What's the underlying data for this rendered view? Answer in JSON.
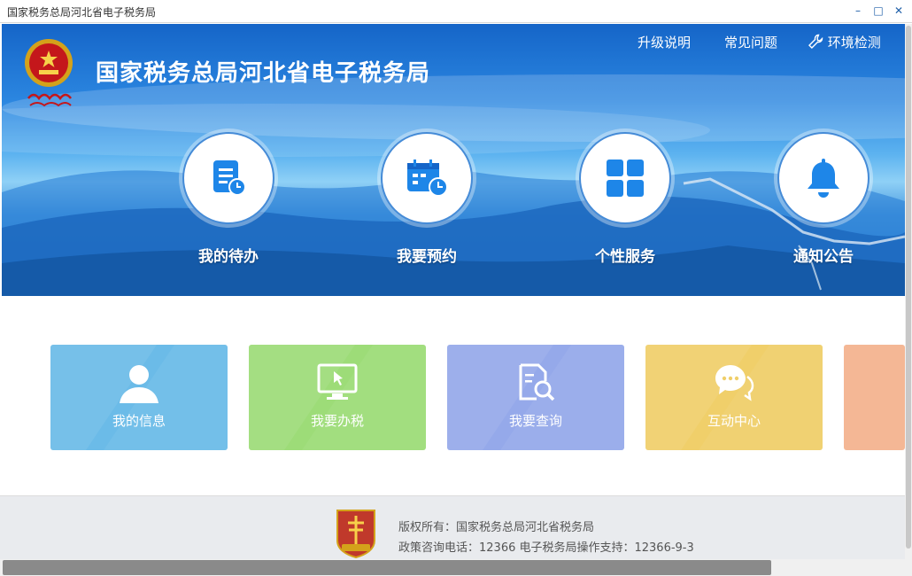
{
  "window": {
    "title": "国家税务总局河北省电子税务局",
    "minimize": "–",
    "maximize": "□",
    "close": "✕"
  },
  "header": {
    "site_title": "国家税务总局河北省电子税务局",
    "links": [
      {
        "label": "升级说明",
        "icon": "none"
      },
      {
        "label": "常见问题",
        "icon": "none"
      },
      {
        "label": "环境检测",
        "icon": "wrench-icon"
      }
    ]
  },
  "services": [
    {
      "label": "我的待办",
      "icon": "todo-document-icon"
    },
    {
      "label": "我要预约",
      "icon": "calendar-clock-icon"
    },
    {
      "label": "个性服务",
      "icon": "grid-apps-icon"
    },
    {
      "label": "通知公告",
      "icon": "bell-icon"
    }
  ],
  "tiles": [
    {
      "label": "我的信息",
      "icon": "user-icon",
      "color": "#6bbbe8"
    },
    {
      "label": "我要办税",
      "icon": "monitor-cursor-icon",
      "color": "#9ddc78"
    },
    {
      "label": "我要查询",
      "icon": "document-search-icon",
      "color": "#95a9ea"
    },
    {
      "label": "互动中心",
      "icon": "chat-bubble-icon",
      "color": "#f0cf6a"
    },
    {
      "label": "",
      "icon": "",
      "color": "#f4b795"
    }
  ],
  "footer": {
    "copyright": "版权所有：国家税务总局河北省税务局",
    "contact": "政策咨询电话：12366  电子税务局操作支持：12366-9-3",
    "badge_icon": "party-government-badge-icon"
  },
  "colors": {
    "banner_top": "#1565c8",
    "ring_blue": "#1a7be0",
    "footer_bg": "#e9ebee"
  }
}
